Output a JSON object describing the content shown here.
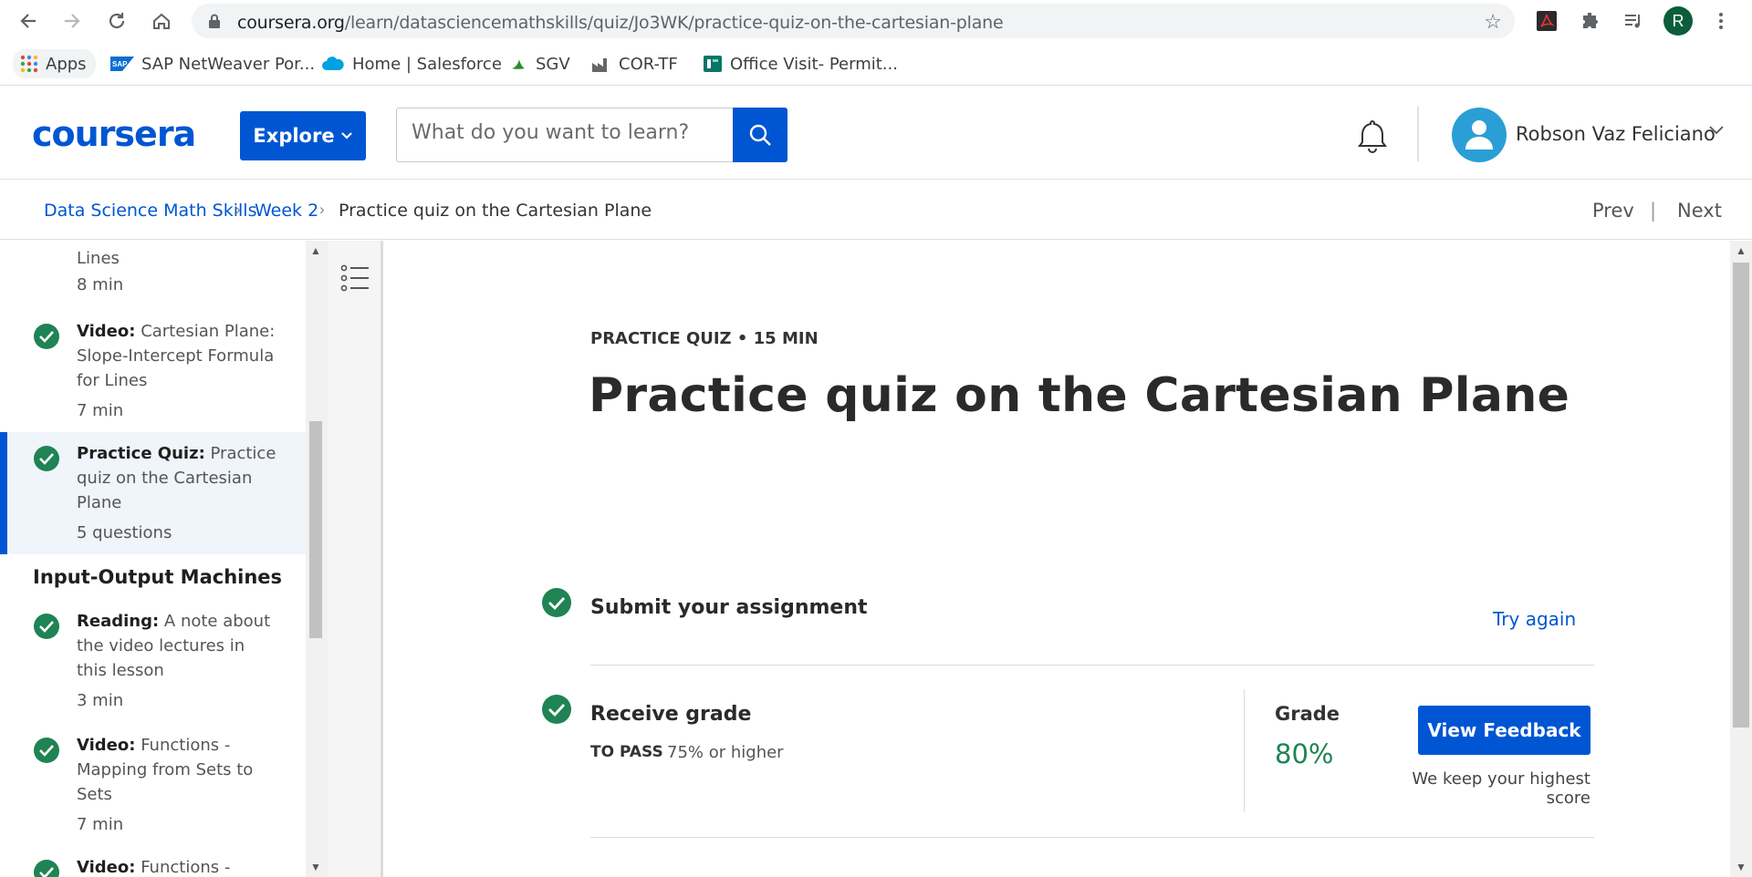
{
  "browser": {
    "url_host": "coursera.org",
    "url_path": "/learn/datasciencemathskills/quiz/Jo3WK/practice-quiz-on-the-cartesian-plane",
    "profile_initial": "R",
    "bookmarks": [
      {
        "label": "Apps",
        "icon": "apps-grid-icon"
      },
      {
        "label": "SAP NetWeaver Por...",
        "icon": "sap-icon"
      },
      {
        "label": "Home | Salesforce",
        "icon": "salesforce-cloud-icon"
      },
      {
        "label": "SGV",
        "icon": "sgv-icon"
      },
      {
        "label": "COR-TF",
        "icon": "factory-icon"
      },
      {
        "label": "Office Visit- Permit...",
        "icon": "forms-icon"
      }
    ]
  },
  "header": {
    "logo": "coursera",
    "explore_label": "Explore",
    "search_placeholder": "What do you want to learn?",
    "user_name": "Robson Vaz Feliciano"
  },
  "breadcrumb": {
    "items": [
      "Data Science Math Skills",
      "Week 2",
      "Practice quiz on the Cartesian Plane"
    ],
    "prev": "Prev",
    "separator": "|",
    "next": "Next"
  },
  "sidebar": {
    "partial_item": {
      "text": "Lines",
      "meta": "8 min"
    },
    "items": [
      {
        "type": "Video:",
        "title": "Cartesian Plane: Slope-Intercept Formula for Lines",
        "meta": "7 min"
      },
      {
        "type": "Practice Quiz:",
        "title": "Practice quiz on the Cartesian Plane",
        "meta": "5 questions"
      },
      {
        "type": "Reading:",
        "title": "A note about the video lectures in this lesson",
        "meta": "3 min"
      },
      {
        "type": "Video:",
        "title": "Functions - Mapping from Sets to Sets",
        "meta": "7 min"
      },
      {
        "type": "Video:",
        "title": "Functions -",
        "meta": ""
      }
    ],
    "section_title": "Input-Output Machines"
  },
  "main": {
    "quiz_meta": "PRACTICE QUIZ • 15 MIN",
    "title": "Practice quiz on the Cartesian Plane",
    "submit_title": "Submit your assignment",
    "try_again": "Try again",
    "receive_title": "Receive grade",
    "to_pass_label": "TO PASS",
    "to_pass_value": "75% or higher",
    "grade_label": "Grade",
    "grade_value": "80%",
    "feedback_button": "View Feedback",
    "keep_score": "We keep your highest score"
  },
  "colors": {
    "brand": "#0056d2",
    "success": "#1f8354",
    "check": "#1f8354"
  }
}
